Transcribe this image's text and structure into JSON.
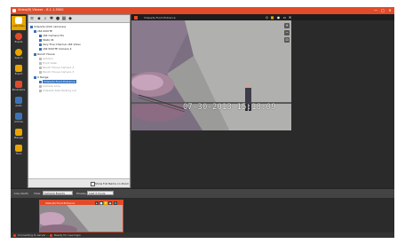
{
  "window": {
    "title": "Video(6) Viewer - 6.1.1.3900",
    "accent": "#e24b2a",
    "minimize": "—",
    "maximize": "□",
    "close": "✕"
  },
  "nav": {
    "items": [
      {
        "label": "Live Video",
        "icon": "live-video-icon",
        "color": "#e8a600",
        "active": true
      },
      {
        "label": "Events",
        "icon": "events-icon",
        "color": "#e24b2a"
      },
      {
        "label": "Search",
        "icon": "search-icon",
        "color": "#e8a600"
      },
      {
        "label": "Export",
        "icon": "export-icon",
        "color": "#e8a600"
      },
      {
        "label": "Bookmarks",
        "icon": "bookmark-icon",
        "color": "#e24b2a"
      },
      {
        "label": "Audio",
        "icon": "audio-icon",
        "color": "#3b73b9"
      },
      {
        "label": "Archive",
        "icon": "archive-icon",
        "color": "#3b73b9"
      },
      {
        "label": "Manage",
        "icon": "manage-icon",
        "color": "#e8a600"
      },
      {
        "label": "Tours",
        "icon": "tours-icon",
        "color": "#e8a600"
      }
    ]
  },
  "tree": {
    "nodes": [
      {
        "label": "Video(6) [XXX cameras]",
        "indent": 0,
        "state": "normal"
      },
      {
        "label": "x64 ROUTE",
        "indent": 1,
        "state": "normal"
      },
      {
        "label": "x64 Camera Hiv",
        "indent": 2,
        "state": "normal"
      },
      {
        "label": "Static IR",
        "indent": 2,
        "state": "normal"
      },
      {
        "label": "Very Fine Channel x64 Video",
        "indent": 2,
        "state": "normal"
      },
      {
        "label": "x64 ROUTE Camera 4",
        "indent": 2,
        "state": "normal"
      },
      {
        "label": "Ranch House",
        "indent": 1,
        "state": "normal"
      },
      {
        "label": "Outdoor",
        "indent": 2,
        "state": "dim"
      },
      {
        "label": "Front Gate",
        "indent": 2,
        "state": "dim"
      },
      {
        "label": "Ranch House Camera 2",
        "indent": 2,
        "state": "dim"
      },
      {
        "label": "Ranch House Camera 3",
        "indent": 2,
        "state": "dim"
      },
      {
        "label": "X Range",
        "indent": 1,
        "state": "normal"
      },
      {
        "label": "Video(6) Front Entrance",
        "indent": 2,
        "state": "selected"
      },
      {
        "label": "Camera Loop",
        "indent": 2,
        "state": "dim"
      },
      {
        "label": "Video(6) Side Parking Lot",
        "indent": 2,
        "state": "dim"
      }
    ]
  },
  "panel_footer": {
    "checkbox_label": "Show Full Name on Zoom"
  },
  "viewer": {
    "title": "Video(6) Front Entrance",
    "timestamp": "07-30-2013  15:18:09"
  },
  "bottombar": {
    "live_label": "Live Alerts",
    "view_label": "View:",
    "view_value": "Camera Events",
    "display_label": "Display:",
    "display_value": "Last 2 hours"
  },
  "thumbnail": {
    "title": "Video(6) Front Entrance"
  },
  "status": {
    "left": "Connecting to server ...",
    "right": "Ready for new login"
  }
}
